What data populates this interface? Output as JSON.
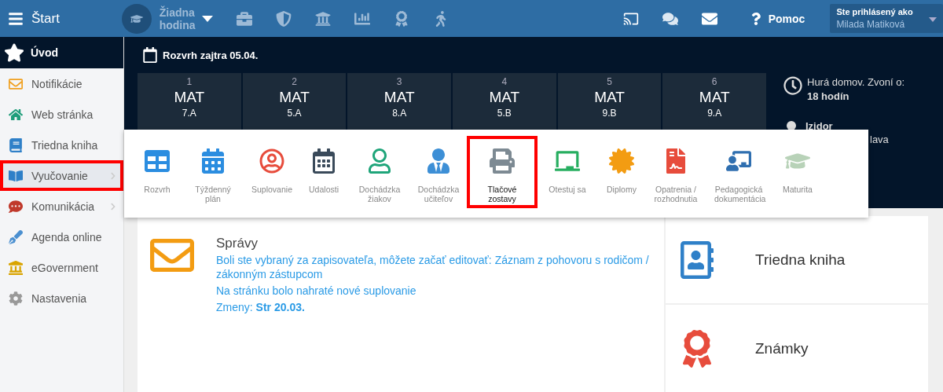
{
  "topbar": {
    "menu_label": "Štart",
    "lesson": "Žiadna hodina",
    "help": "Pomoc",
    "user": {
      "label": "Ste prihlásený ako",
      "name": "Milada Matiková"
    }
  },
  "sidebar": {
    "header": "Úvod",
    "items": [
      {
        "label": "Notifikácie",
        "selected": false,
        "submenu": false,
        "highlighted": false
      },
      {
        "label": "Web stránka",
        "selected": false,
        "submenu": false,
        "highlighted": false
      },
      {
        "label": "Triedna kniha",
        "selected": false,
        "submenu": false,
        "highlighted": false
      },
      {
        "label": "Vyučovanie",
        "selected": true,
        "submenu": true,
        "highlighted": true
      },
      {
        "label": "Komunikácia",
        "selected": false,
        "submenu": true,
        "highlighted": false
      },
      {
        "label": "Agenda online",
        "selected": false,
        "submenu": false,
        "highlighted": false
      },
      {
        "label": "eGovernment",
        "selected": false,
        "submenu": false,
        "highlighted": false
      },
      {
        "label": "Nastavenia",
        "selected": false,
        "submenu": false,
        "highlighted": false
      }
    ]
  },
  "schedule": {
    "title": "Rozvrh zajtra 05.04.",
    "lessons": [
      {
        "number": "1",
        "subject": "MAT",
        "class": "7.A"
      },
      {
        "number": "2",
        "subject": "MAT",
        "class": "5.A"
      },
      {
        "number": "3",
        "subject": "MAT",
        "class": "8.A"
      },
      {
        "number": "4",
        "subject": "MAT",
        "class": "5.B"
      },
      {
        "number": "5",
        "subject": "MAT",
        "class": "9.B"
      },
      {
        "number": "6",
        "subject": "MAT",
        "class": "9.A"
      }
    ]
  },
  "info": {
    "bell_text": "Hurá domov. Zvoní o:",
    "bell_time": "18 hodín",
    "person": "Izidor",
    "person_line": "lava"
  },
  "submenu": {
    "items": [
      {
        "label": "Rozvrh",
        "selected": false,
        "highlighted": false
      },
      {
        "label": "Týždenný plán",
        "selected": false,
        "highlighted": false
      },
      {
        "label": "Suplovanie",
        "selected": false,
        "highlighted": false
      },
      {
        "label": "Udalosti",
        "selected": false,
        "highlighted": false
      },
      {
        "label": "Dochádzka žiakov",
        "selected": false,
        "highlighted": false
      },
      {
        "label": "Dochádzka učiteľov",
        "selected": false,
        "highlighted": false
      },
      {
        "label": "Tlačové zostavy",
        "selected": true,
        "highlighted": true
      },
      {
        "label": "Otestuj sa",
        "selected": false,
        "highlighted": false
      },
      {
        "label": "Diplomy",
        "selected": false,
        "highlighted": false
      },
      {
        "label": "Opatrenia / rozhodnutia",
        "selected": false,
        "highlighted": false
      },
      {
        "label": "Pedagogická dokumentácia",
        "selected": false,
        "highlighted": false
      },
      {
        "label": "Maturita",
        "selected": false,
        "highlighted": false
      }
    ]
  },
  "messages": {
    "title": "Správy",
    "lines": [
      "Boli ste vybraný za zapisovateľa, môžete začať editovať: Záznam z pohovoru s rodičom / zákonným zástupcom",
      "Na stránku bolo nahraté nové suplovanie",
      "Zmeny: **Str 20.03.**"
    ]
  },
  "tiles": [
    "Triedna kniha",
    "Známky"
  ]
}
